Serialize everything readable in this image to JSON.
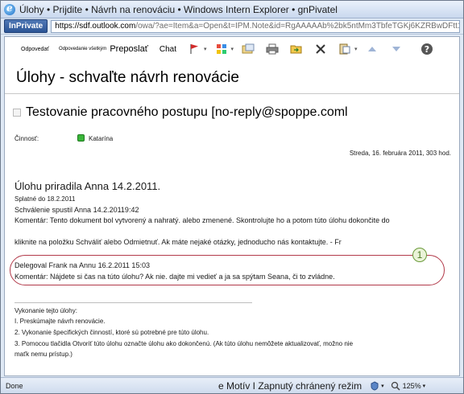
{
  "window": {
    "title": "Úlohy • Prijdite • Návrh na renováciu • Windows Intern Explorer • gnPivatel"
  },
  "address": {
    "inprivate_label": "InPrivate",
    "url_host": "https://sdf.outlook.com",
    "url_rest": "/owa/?ae=Item&a=Open&t=IPM.Note&id=RgAAAAAb%2bk5ntMm3TbfeTGKj6KZRBwDFtt1A\\"
  },
  "toolbar": {
    "reply": "Odpovedať",
    "reply_all": "Odpovedanie všetkým",
    "forward": "Preposlať",
    "chat": "Chat"
  },
  "message": {
    "subject_title": "Úlohy - schvaľte návrh renovácie",
    "sender_line": "Testovanie pracovného postupu [no-reply@spoppe.coml",
    "activity_label": "Činnosť:",
    "activity_person": "Katarína",
    "date_line": "Streda, 16. februára 2011, 303 hod.",
    "assigned_title": "Úlohu priradila Anna 14.2.2011.",
    "due": "Splatné do 18.2.2011",
    "approval_started": "Schválenie spustil Anna 14.2.20119:42",
    "comment_1": "Komentár: Tento dokument bol vytvorený a nahratý. alebo zmenené. Skontrolujte ho a potom túto úlohu dokončite do",
    "comment_2": "kliknite na položku Schváliť alebo Odmietnuť. Ak máte nejaké otázky, jednoducho nás kontaktujte. - Fr",
    "delegated": "Delegoval Frank na Annu 16.2.2011 15:03",
    "delegated_comment": "Komentár: Nájdete si čas na túto úlohu? Ak nie. dajte mi vedieť a ja sa spýtam Seana, či to zvládne.",
    "callout_number": "1",
    "instructions_title": "Vykonanie tejto úlohy:",
    "step_1": "I. Preskúmajte návrh renovácie.",
    "step_2": "2. Vykonanie špecifických činností, ktoré sú potrebné pre túto úlohu.",
    "step_3a": "3. Pomocou tlačidla Otvoriť túto úlohu označte úlohu ako dokončenú. (Ak túto úlohu nemôžete aktualizovať, možno nie",
    "step_3b": "maťk nemu prístup.)"
  },
  "status": {
    "done": "Done",
    "zone": "e Motív I Zapnutý chránený režim",
    "zoom": "125%"
  }
}
